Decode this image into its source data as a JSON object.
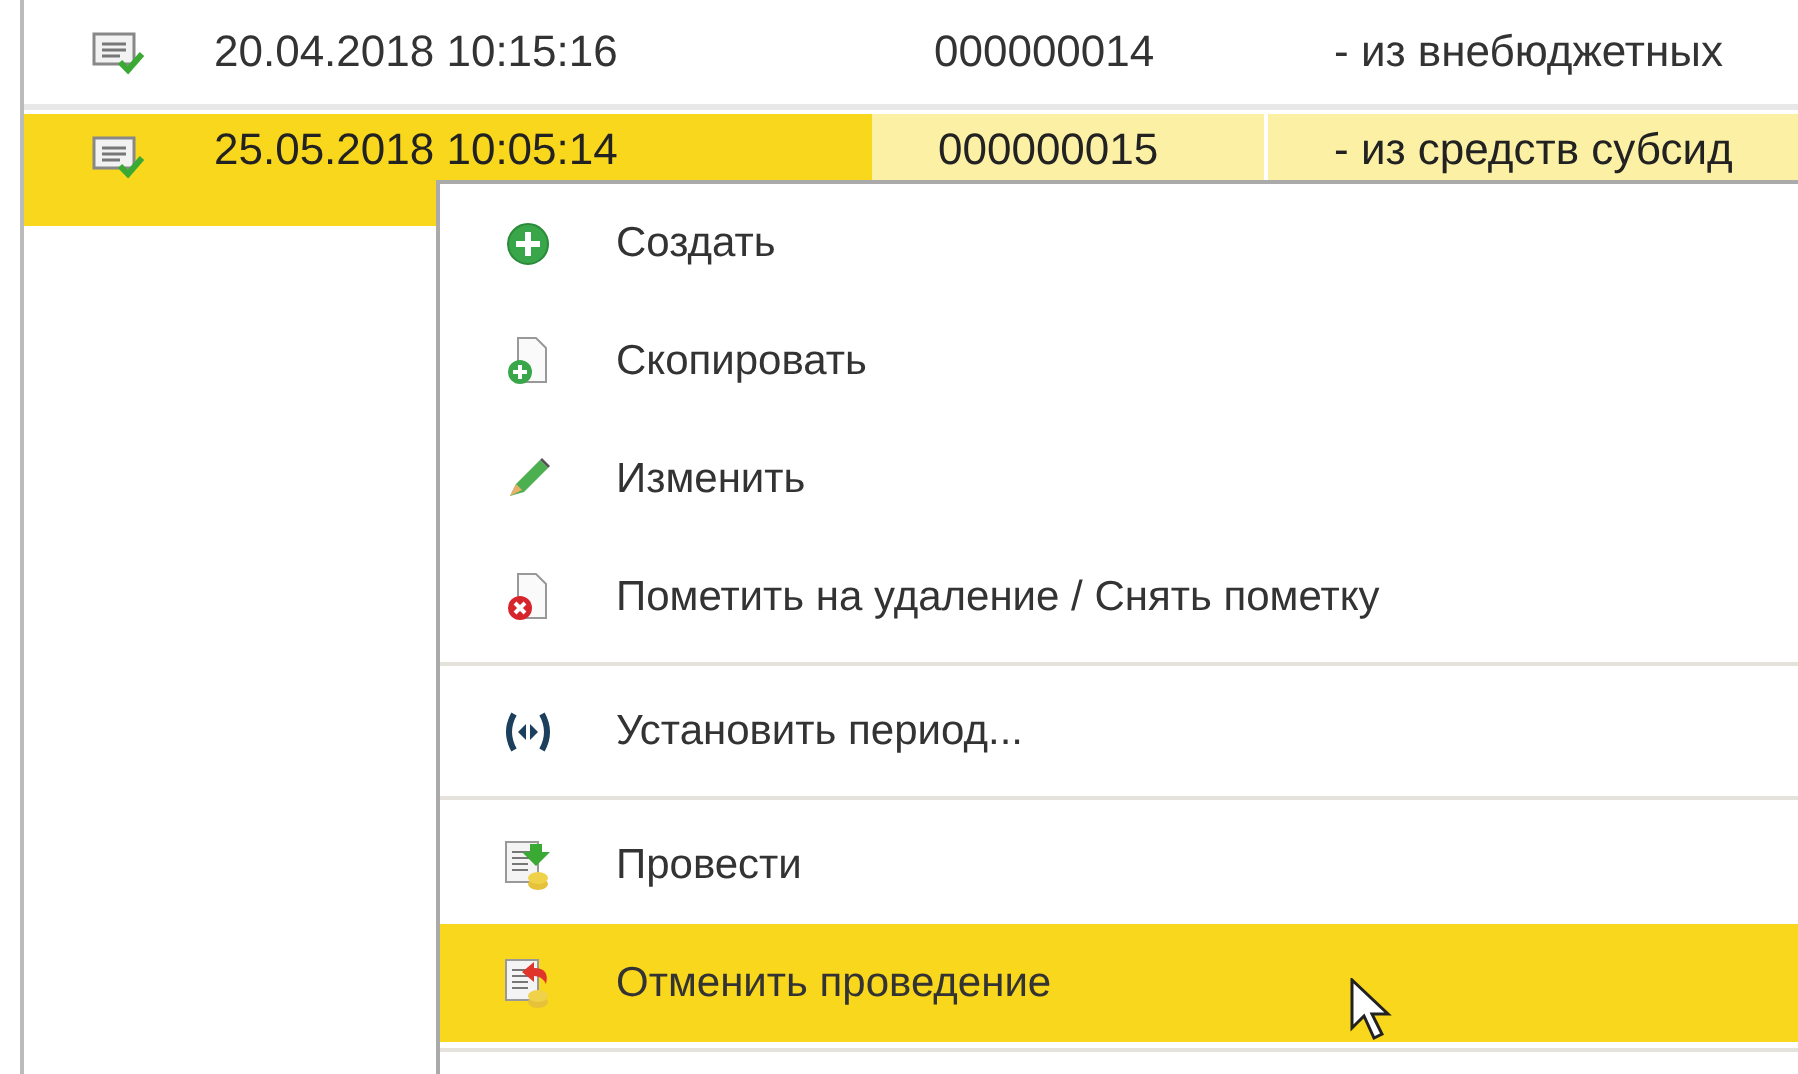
{
  "table": {
    "rows": [
      {
        "posted": true,
        "selected": false,
        "column_1": "20.04.2018 10:15:16",
        "column_2": "000000014",
        "column_3": "- из внебюджетных"
      },
      {
        "posted": true,
        "selected": true,
        "column_1": "25.05.2018 10:05:14",
        "column_2": "000000015",
        "column_3": "- из средств субсид"
      }
    ]
  },
  "context_menu": {
    "items": [
      {
        "kind": "command",
        "label": "Создать",
        "selected": false
      },
      {
        "kind": "command",
        "label": "Скопировать",
        "selected": false
      },
      {
        "kind": "command",
        "label": "Изменить",
        "selected": false
      },
      {
        "kind": "command",
        "label": "Пометить на удаление / Снять пометку",
        "selected": false
      },
      {
        "kind": "separator"
      },
      {
        "kind": "command",
        "label": "Установить период...",
        "selected": false
      },
      {
        "kind": "separator"
      },
      {
        "kind": "command",
        "label": "Провести",
        "selected": false
      },
      {
        "kind": "command",
        "label": "Отменить проведение",
        "selected": true
      },
      {
        "kind": "separator"
      }
    ]
  }
}
